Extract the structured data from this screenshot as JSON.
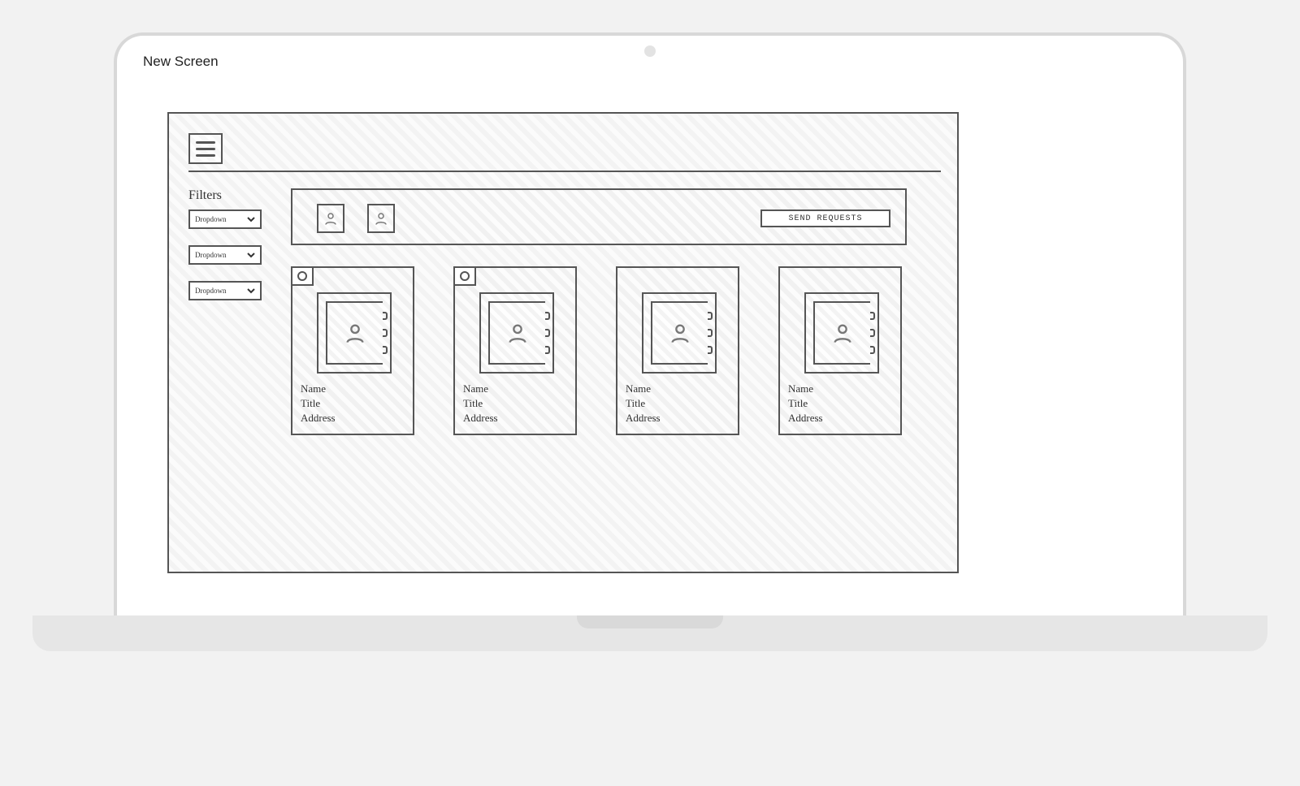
{
  "screenTitle": "New Screen",
  "sidebar": {
    "filtersLabel": "Filters",
    "dropdowns": [
      "Dropdown",
      "Dropdown",
      "Dropdown"
    ]
  },
  "toolbar": {
    "selectedCount": 2,
    "sendLabel": "SEND REQUESTS"
  },
  "cards": [
    {
      "name": "Name",
      "title": "Title",
      "address": "Address",
      "selected": true
    },
    {
      "name": "Name",
      "title": "Title",
      "address": "Address",
      "selected": true
    },
    {
      "name": "Name",
      "title": "Title",
      "address": "Address",
      "selected": false
    },
    {
      "name": "Name",
      "title": "Title",
      "address": "Address",
      "selected": false
    }
  ]
}
